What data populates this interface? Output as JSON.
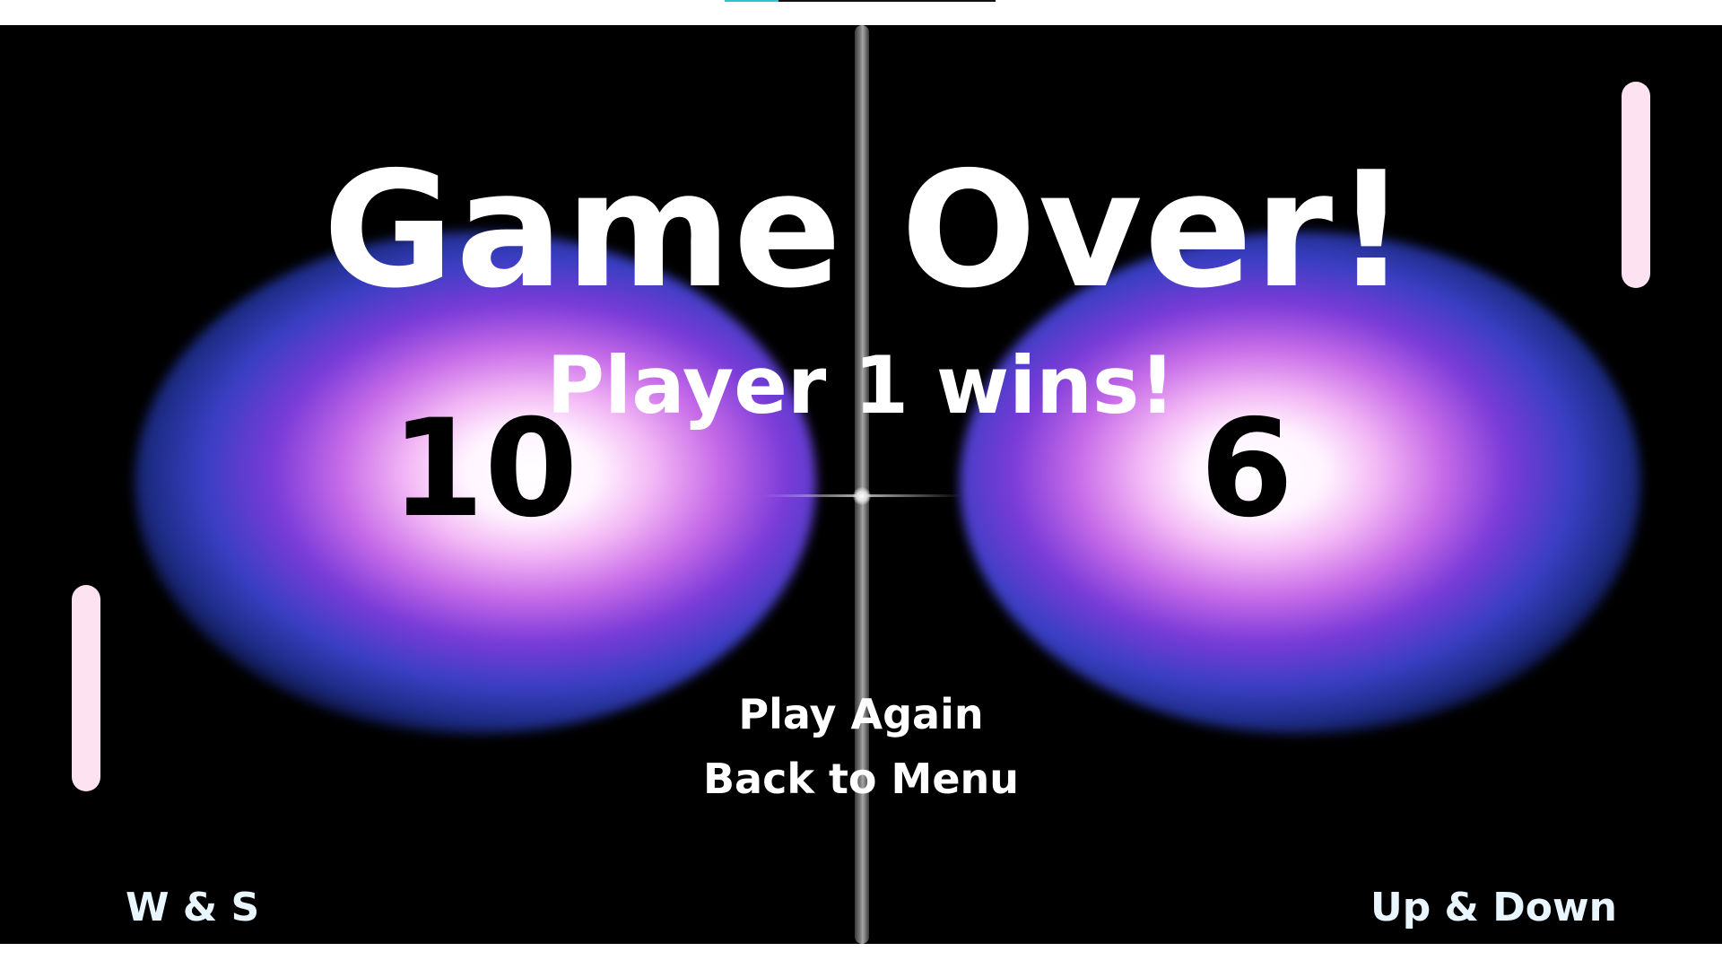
{
  "header": {
    "progress": 0.2,
    "progress_color": "#31c0d4"
  },
  "game": {
    "title": "Game Over!",
    "winner_text": "Player 1 wins!",
    "scores": {
      "player1": "10",
      "player2": "6"
    },
    "menu": {
      "play_again": "Play Again",
      "back_to_menu": "Back to Menu"
    },
    "controls": {
      "player1": "W & S",
      "player2": "Up & Down"
    }
  },
  "colors": {
    "background": "#000000",
    "paddle": "#fde3f1",
    "text": "#ffffff",
    "score": "#000000",
    "nebula_core": "#ffffff",
    "nebula_mid": "#c66ae8",
    "nebula_outer": "#3a3fc4"
  }
}
